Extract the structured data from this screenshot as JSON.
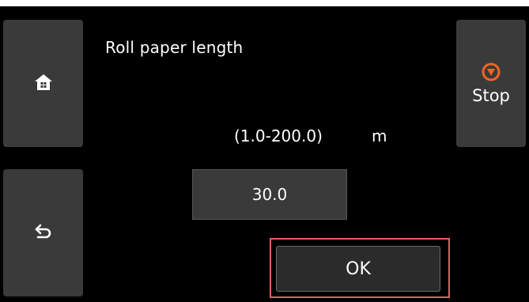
{
  "screen": {
    "title": "Roll paper length",
    "range_text": "(1.0-200.0)",
    "unit": "m"
  },
  "input": {
    "value": "30.0"
  },
  "buttons": {
    "ok_label": "OK",
    "stop_label": "Stop",
    "home_icon": "home-icon",
    "back_icon": "back-arrow-icon",
    "stop_icon": "stop-icon"
  },
  "colors": {
    "background": "#000000",
    "button": "#3a3a3a",
    "stop_icon": "#f26522",
    "highlight_border": "#e65e63"
  }
}
